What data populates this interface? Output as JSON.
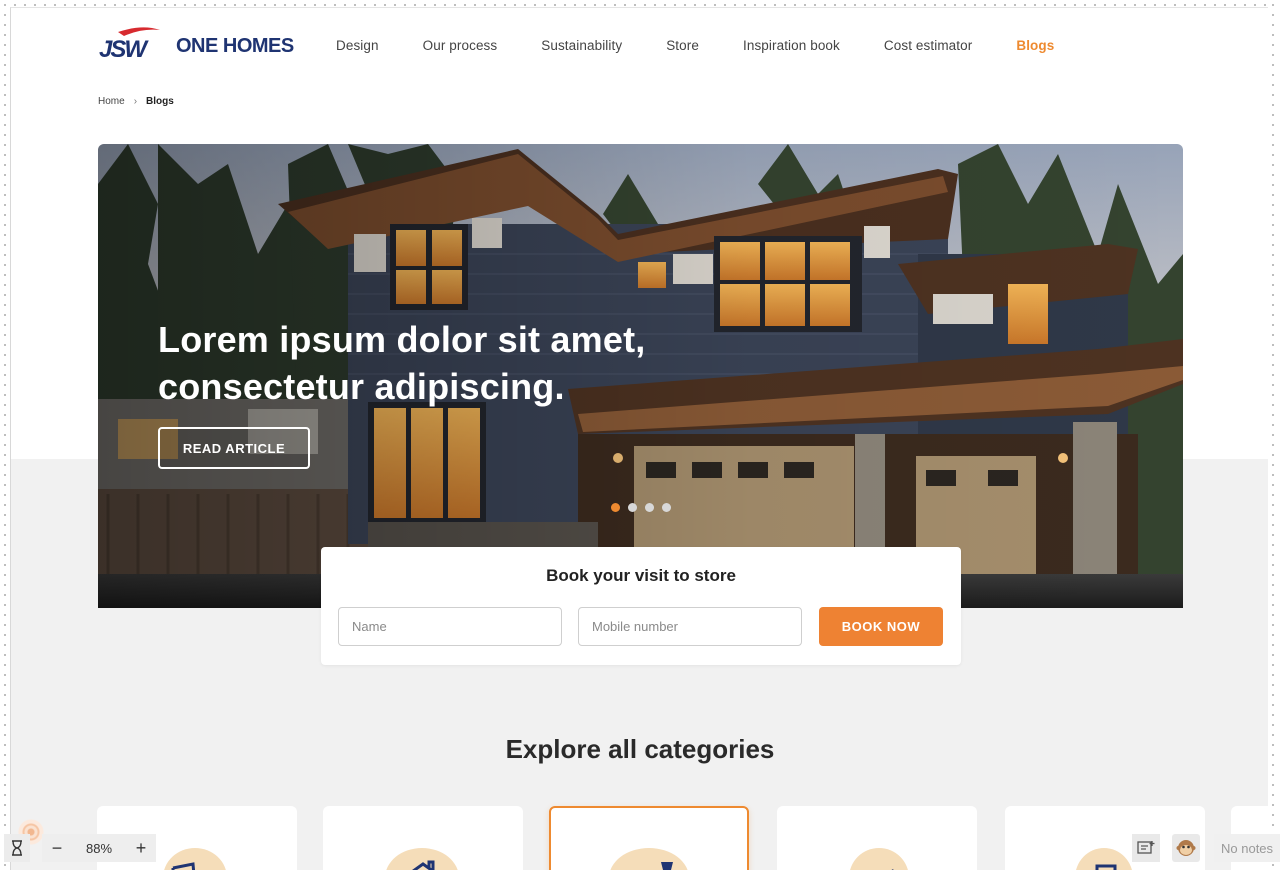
{
  "brand": {
    "logo_text": "ONE HOMES",
    "logo_mark": "JSW",
    "colors": {
      "navy": "#1f3472",
      "red": "#d72a2f",
      "accent": "#ee8a30"
    }
  },
  "nav": {
    "items": [
      {
        "label": "Design"
      },
      {
        "label": "Our process"
      },
      {
        "label": "Sustainability"
      },
      {
        "label": "Store"
      },
      {
        "label": "Inspiration book"
      },
      {
        "label": "Cost estimator"
      },
      {
        "label": "Blogs",
        "active": true
      }
    ]
  },
  "breadcrumb": {
    "home": "Home",
    "current": "Blogs"
  },
  "hero": {
    "title_line1": "Lorem ipsum dolor sit amet,",
    "title_line2": "consectetur adipiscing.",
    "button_label": "READ ARTICLE",
    "slides": 4,
    "active_slide": 1
  },
  "booking": {
    "title": "Book your visit to store",
    "name_placeholder": "Name",
    "mobile_placeholder": "Mobile number",
    "button_label": "BOOK NOW"
  },
  "categories": {
    "heading": "Explore all categories",
    "items": [
      {
        "icon": "door-icon"
      },
      {
        "icon": "house-icon"
      },
      {
        "icon": "lamp-icon",
        "selected": true
      },
      {
        "icon": "butterfly-icon"
      },
      {
        "icon": "toolbox-icon"
      }
    ]
  },
  "toolbar": {
    "zoom_value": "88%",
    "zoom_out_label": "−",
    "zoom_in_label": "+",
    "notes_label": "No notes"
  }
}
